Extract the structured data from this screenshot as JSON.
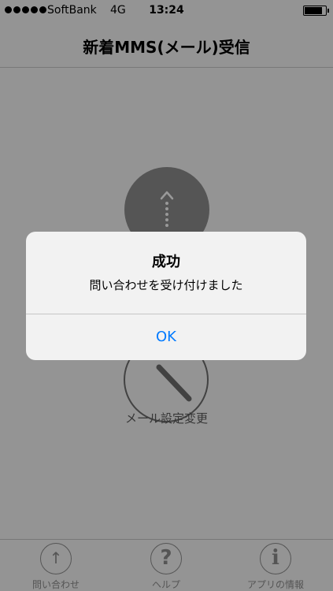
{
  "status_bar": {
    "carrier": "SoftBank",
    "network": "4G",
    "time": "13:24",
    "signal_bars": 5,
    "battery_level": 0.85
  },
  "nav": {
    "title": "新着MMS(メール)受信"
  },
  "main": {
    "receive_icon": "arrow-up-dotted-icon",
    "settings_icon": "wrench-icon",
    "settings_label": "メール設定変更"
  },
  "tabs": [
    {
      "label": "問い合わせ",
      "icon": "arrow-up-icon",
      "glyph": "↑"
    },
    {
      "label": "ヘルプ",
      "icon": "question-icon",
      "glyph": "?"
    },
    {
      "label": "アプリの情報",
      "icon": "info-icon",
      "glyph": "i"
    }
  ],
  "alert": {
    "title": "成功",
    "message": "問い合わせを受け付けました",
    "ok_label": "OK"
  },
  "colors": {
    "accent": "#007aff",
    "overlay": "rgba(0,0,0,0.4)"
  }
}
